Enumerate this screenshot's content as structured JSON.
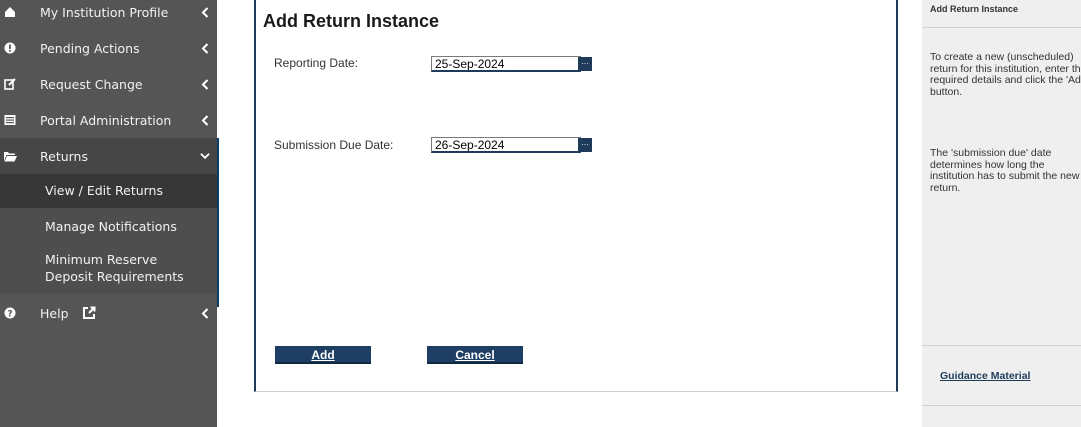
{
  "sidebar": {
    "items": [
      {
        "label": "My Institution Profile",
        "icon": "home-icon"
      },
      {
        "label": "Pending Actions",
        "icon": "exclamation-icon"
      },
      {
        "label": "Request Change",
        "icon": "edit-icon"
      },
      {
        "label": "Portal Administration",
        "icon": "list-icon"
      },
      {
        "label": "Returns",
        "icon": "folder-open-icon"
      }
    ],
    "sub_items": [
      {
        "label": "View / Edit Returns"
      },
      {
        "label": "Manage Notifications"
      },
      {
        "label": "Minimum Reserve Deposit Requirements"
      }
    ],
    "help": {
      "label": "Help",
      "icon": "question-icon"
    }
  },
  "main": {
    "title": "Add Return Instance",
    "reporting_date": {
      "label": "Reporting Date:",
      "value": "25-Sep-2024"
    },
    "due_date": {
      "label": "Submission Due Date:",
      "value": "26-Sep-2024"
    },
    "picker_label": "...",
    "add_label": "Add",
    "cancel_label": "Cancel"
  },
  "help_panel": {
    "title": "Add Return Instance",
    "para1": "To create a new (unscheduled) return for this institution, enter the required details and click the 'Add' button.",
    "para2": "The 'submission due' date determines how long the institution has to submit the new return.",
    "guidance_link": "Guidance Material"
  },
  "colors": {
    "sidebar_bg": "#555555",
    "accent": "#1e3c5a",
    "help_bg": "#efefef"
  }
}
